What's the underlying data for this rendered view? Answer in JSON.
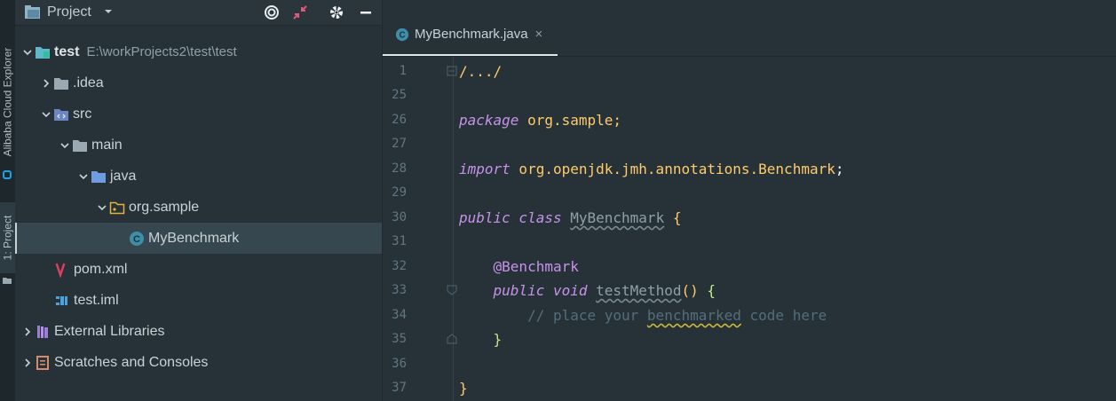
{
  "left_strip": {
    "tab_cloud": "Alibaba Cloud Explorer",
    "tab_project": "1: Project"
  },
  "project_panel": {
    "title": "Project",
    "tree": [
      {
        "label": "test",
        "path": "E:\\workProjects2\\test\\test",
        "icon": "module-folder-icon"
      },
      {
        "label": ".idea",
        "icon": "folder-icon"
      },
      {
        "label": "src",
        "icon": "source-folder-icon"
      },
      {
        "label": "main",
        "icon": "folder-icon"
      },
      {
        "label": "java",
        "icon": "java-source-folder-icon"
      },
      {
        "label": "org.sample",
        "icon": "package-icon"
      },
      {
        "label": "MyBenchmark",
        "icon": "java-class-icon"
      },
      {
        "label": "pom.xml",
        "icon": "maven-icon"
      },
      {
        "label": "test.iml",
        "icon": "iml-file-icon"
      },
      {
        "label": "External Libraries",
        "icon": "libraries-icon"
      },
      {
        "label": "Scratches and Consoles",
        "icon": "scratches-icon"
      }
    ]
  },
  "editor": {
    "tab": {
      "label": "MyBenchmark.java",
      "close": "×"
    },
    "line_numbers": [
      "1",
      "25",
      "26",
      "27",
      "28",
      "29",
      "30",
      "31",
      "32",
      "33",
      "34",
      "35",
      "36",
      "37"
    ],
    "code": {
      "l1": "/.../",
      "l26_kw": "package",
      "l26_rest": " org.sample;",
      "l28_kw": "import",
      "l28_pkg": " org.openjdk.jmh.annotations.",
      "l28_cls": "Benchmark",
      "l28_semi": ";",
      "l30_kw": "public class",
      "l30_name": "MyBenchmark",
      "l30_brace": "{",
      "l32_ann": "@Benchmark",
      "l33_kw": "public void",
      "l33_name": "testMethod",
      "l33_parens": "()",
      "l33_brace": "{",
      "l34_c1": "// place your ",
      "l34_c2": "benchmarked",
      "l34_c3": " code here",
      "l35_brace": "}",
      "l37_brace": "}"
    }
  },
  "colors": {
    "background": "#263238",
    "keyword": "#c792ea",
    "class": "#ffcb6b",
    "comment": "#546e7a"
  }
}
